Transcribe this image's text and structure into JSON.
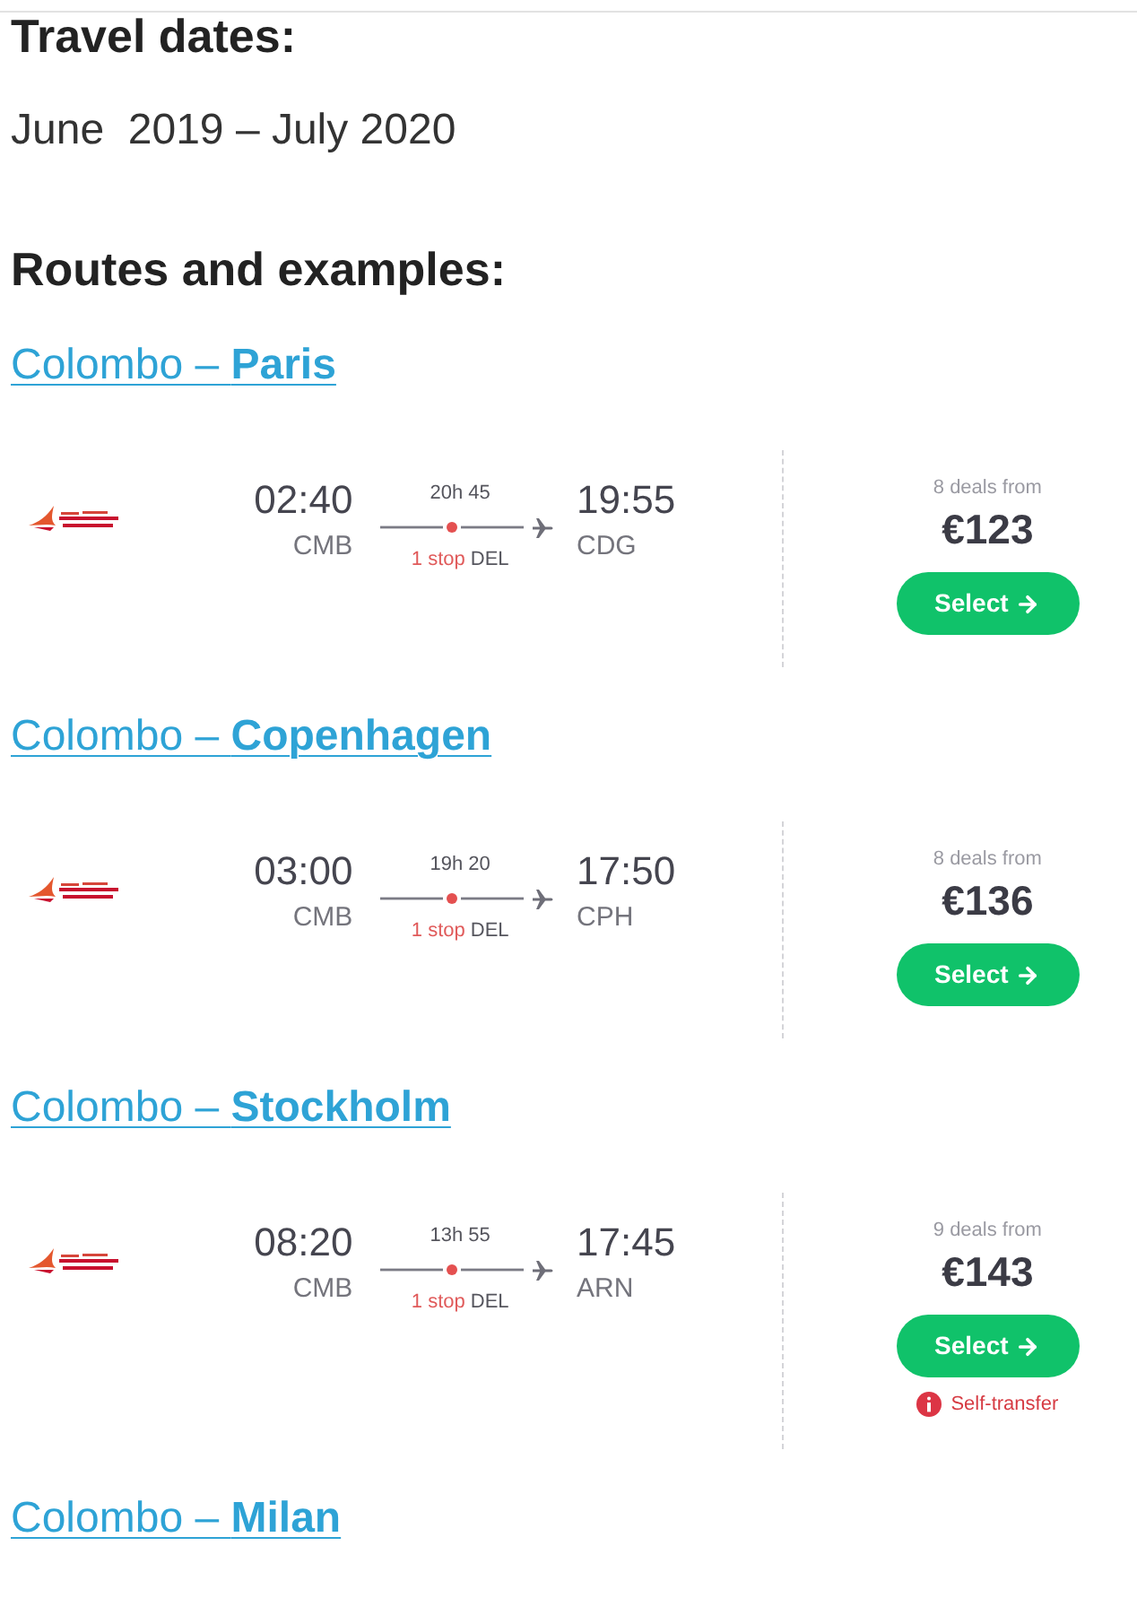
{
  "travel_dates": {
    "heading": "Travel dates:",
    "range": "June  2019 – July 2020"
  },
  "routes": {
    "heading": "Routes and examples:",
    "items": [
      {
        "title": "Colombo – **Paris**",
        "example": {
          "departure": {
            "time": "02:40",
            "airport": "CMB"
          },
          "duration": "20h 45",
          "stop": {
            "count": "1 stop",
            "airport": "DEL"
          },
          "arrival": {
            "time": "19:55",
            "airport": "CDG"
          },
          "deals": "8 deals from",
          "price": "€123",
          "button": "Select"
        }
      },
      {
        "title": "Colombo – **Copenhagen**",
        "example": {
          "departure": {
            "time": "03:00",
            "airport": "CMB"
          },
          "duration": "19h 20",
          "stop": {
            "count": "1 stop",
            "airport": "DEL"
          },
          "arrival": {
            "time": "17:50",
            "airport": "CPH"
          },
          "deals": "8 deals from",
          "price": "€136",
          "button": "Select"
        }
      },
      {
        "title": "Colombo – **Stockholm**",
        "example": {
          "departure": {
            "time": "08:20",
            "airport": "CMB"
          },
          "duration": "13h 55",
          "stop": {
            "count": "1 stop",
            "airport": "DEL"
          },
          "arrival": {
            "time": "17:45",
            "airport": "ARN"
          },
          "deals": "9 deals from",
          "price": "€143",
          "button": "Select",
          "note": "Self-transfer"
        }
      },
      {
        "title": "Colombo – **Milan**"
      }
    ]
  }
}
